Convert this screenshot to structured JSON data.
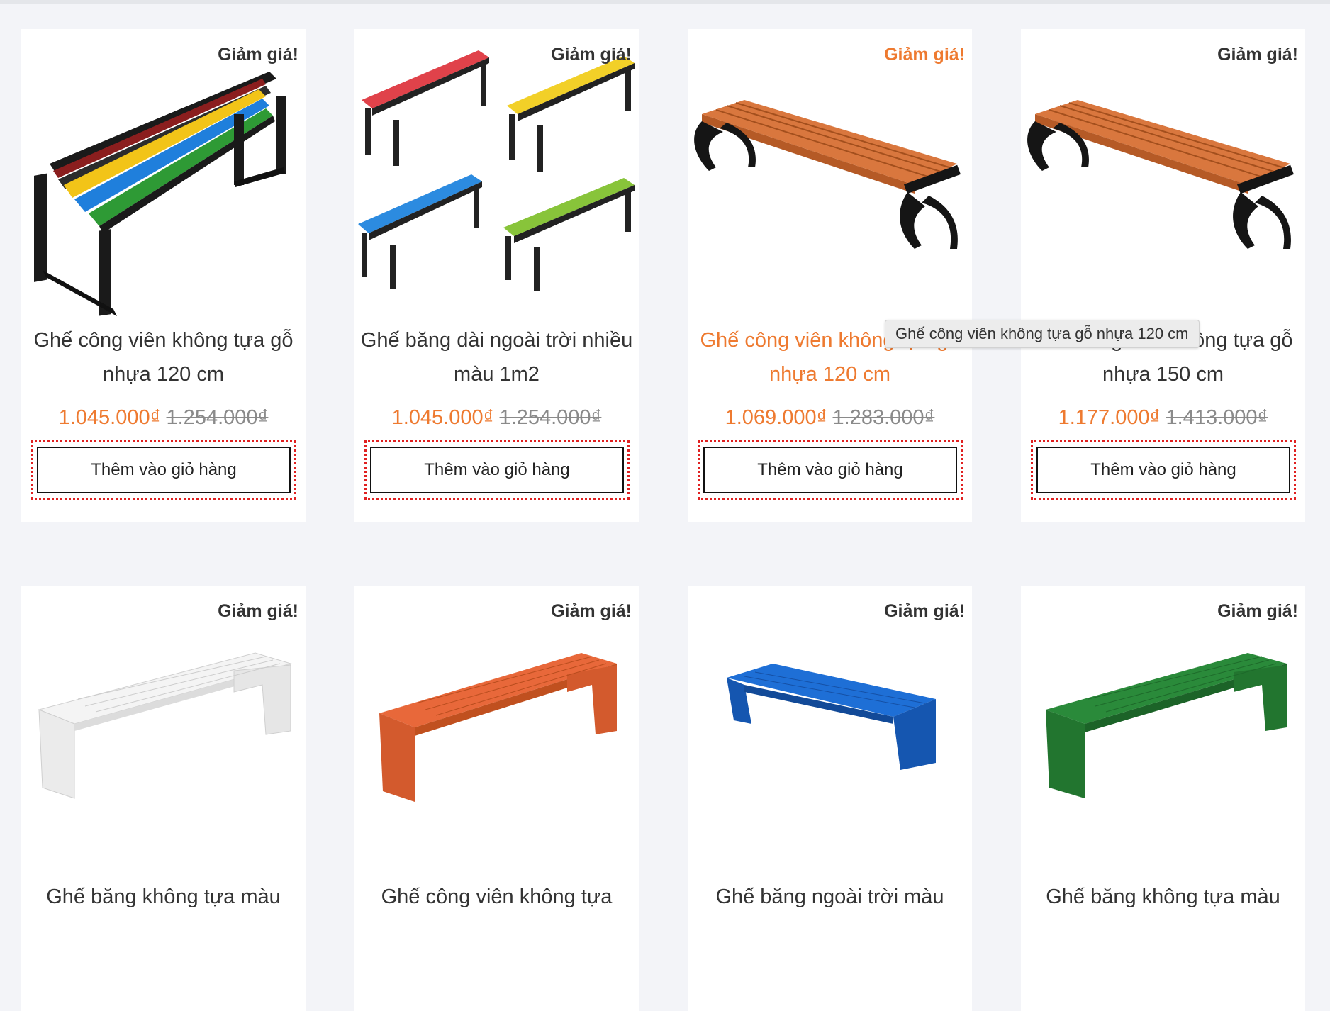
{
  "colors": {
    "accent": "#ee7a30",
    "text": "#333333",
    "strike": "#8a8a8a",
    "button_outline": "#e02020",
    "background": "#f3f4f8"
  },
  "tooltip": "Ghế công viên không tựa gỗ nhựa 120 cm",
  "products": [
    {
      "badge": "Giảm giá!",
      "title_line1": "Ghế công viên không tựa gỗ",
      "title_line2": "nhựa 120 cm",
      "price_new": "1.045.000₫",
      "price_old": "1.254.000₫",
      "button": "Thêm vào giỏ hàng",
      "image": "multicolor-slat-bench"
    },
    {
      "badge": "Giảm giá!",
      "title_line1": "Ghế băng dài ngoài trời nhiều",
      "title_line2": "màu 1m2",
      "price_new": "1.045.000₫",
      "price_old": "1.254.000₫",
      "button": "Thêm vào giỏ hàng",
      "image": "four-color-benches"
    },
    {
      "badge": "Giảm giá!",
      "title_line1": "Ghế công viên không tựa gỗ",
      "title_line2": "nhựa 120 cm",
      "price_new": "1.069.000₫",
      "price_old": "1.283.000₫",
      "button": "Thêm vào giỏ hàng",
      "image": "orange-park-bench"
    },
    {
      "badge": "Giảm giá!",
      "title_line1": "Ghế công viên không tựa gỗ",
      "title_line2": "nhựa 150 cm",
      "price_new": "1.177.000₫",
      "price_old": "1.413.000₫",
      "button": "Thêm vào giỏ hàng",
      "image": "orange-park-bench"
    },
    {
      "badge": "Giảm giá!",
      "title_line1": "Ghế băng không tựa màu",
      "image": "white-composite-bench"
    },
    {
      "badge": "Giảm giá!",
      "title_line1": "Ghế công viên không tựa",
      "image": "orange-composite-bench"
    },
    {
      "badge": "Giảm giá!",
      "title_line1": "Ghế băng ngoài trời màu",
      "image": "blue-composite-bench"
    },
    {
      "badge": "Giảm giá!",
      "title_line1": "Ghế băng không tựa màu",
      "image": "green-composite-bench"
    }
  ]
}
